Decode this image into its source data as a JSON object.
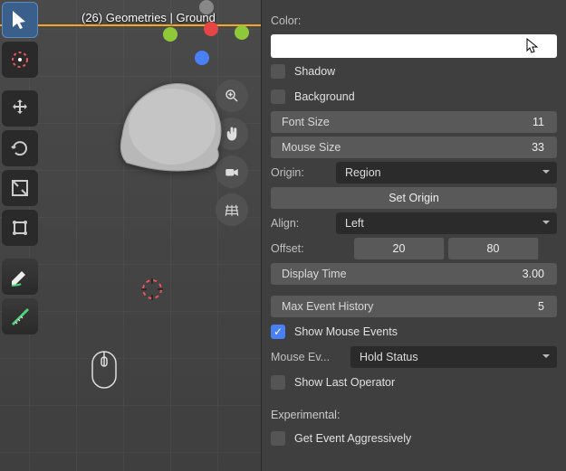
{
  "header": {
    "text": "(26) Geometries | Ground"
  },
  "viewport": {
    "tools": [
      "select",
      "cursor",
      "move",
      "rotate",
      "scale",
      "transform",
      "annotate",
      "measure"
    ]
  },
  "nav": [
    "zoom",
    "pan",
    "camera",
    "ortho"
  ],
  "panel": {
    "color_label": "Color:",
    "shadow": {
      "label": "Shadow",
      "checked": false
    },
    "background": {
      "label": "Background",
      "checked": false
    },
    "font_size": {
      "label": "Font Size",
      "value": "11"
    },
    "mouse_size": {
      "label": "Mouse Size",
      "value": "33"
    },
    "origin": {
      "label": "Origin:",
      "value": "Region"
    },
    "set_origin": "Set Origin",
    "align": {
      "label": "Align:",
      "value": "Left"
    },
    "offset": {
      "label": "Offset:",
      "x": "20",
      "y": "80"
    },
    "display_time": {
      "label": "Display Time",
      "value": "3.00"
    },
    "max_history": {
      "label": "Max Event History",
      "value": "5"
    },
    "show_mouse": {
      "label": "Show Mouse Events",
      "checked": true
    },
    "mouse_ev_sel": {
      "label": "Mouse Ev...",
      "value": "Hold Status"
    },
    "show_last_op": {
      "label": "Show Last Operator",
      "checked": false
    },
    "experimental_label": "Experimental:",
    "get_event_aggr": {
      "label": "Get Event Aggressively",
      "checked": false
    }
  }
}
